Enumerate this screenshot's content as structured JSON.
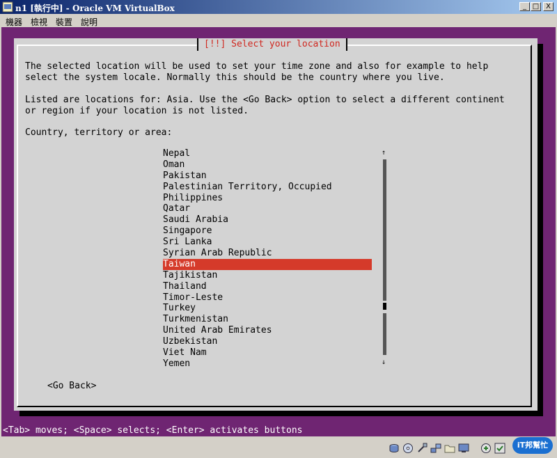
{
  "window": {
    "title": "n1 [執行中] - Oracle VM VirtualBox",
    "minimize_glyph": "_",
    "restore_glyph": "□",
    "close_glyph": "X"
  },
  "menu": {
    "items": [
      "機器",
      "檢視",
      "裝置",
      "說明"
    ]
  },
  "dialog": {
    "title": "[!!] Select your location",
    "para1_line1": "The selected location will be used to set your time zone and also for example to help",
    "para1_line2": "select the system locale. Normally this should be the country where you live.",
    "para2_line1": "Listed are locations for: Asia. Use the <Go Back> option to select a different continent",
    "para2_line2": "or region if your location is not listed.",
    "prompt": "Country, territory or area:",
    "countries": [
      "Nepal",
      "Oman",
      "Pakistan",
      "Palestinian Territory, Occupied",
      "Philippines",
      "Qatar",
      "Saudi Arabia",
      "Singapore",
      "Sri Lanka",
      "Syrian Arab Republic",
      "Taiwan",
      "Tajikistan",
      "Thailand",
      "Timor-Leste",
      "Turkey",
      "Turkmenistan",
      "United Arab Emirates",
      "Uzbekistan",
      "Viet Nam",
      "Yemen"
    ],
    "selected_country": "Taiwan",
    "scroll_up_glyph": "↑",
    "scroll_down_glyph": "↓",
    "go_back": "<Go Back>"
  },
  "help_line": "<Tab> moves; <Space> selects; <Enter> activates buttons",
  "statusbar": {
    "icons": [
      "hard-disk-icon",
      "optical-drive-icon",
      "usb-icon",
      "network-icon",
      "shared-folder-icon",
      "display-icon",
      "capture-icon",
      "host-key-icon"
    ]
  },
  "watermark": {
    "text": "iT邦幫忙"
  },
  "colors": {
    "vm_background": "#6f2572",
    "dialog_background": "#d3d3d3",
    "title_red": "#d02820",
    "selection_red": "#d53a2a"
  }
}
